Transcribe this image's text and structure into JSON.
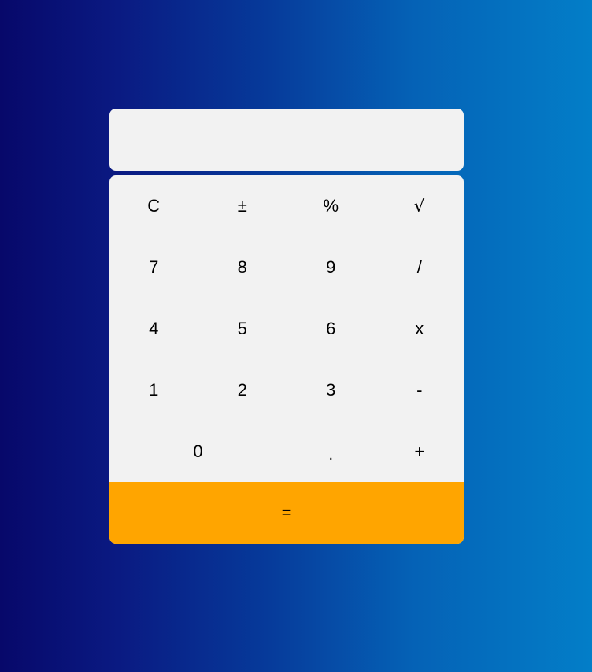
{
  "display": {
    "value": ""
  },
  "keys": {
    "clear": "C",
    "sign": "±",
    "percent": "%",
    "sqrt": "√",
    "seven": "7",
    "eight": "8",
    "nine": "9",
    "divide": "/",
    "four": "4",
    "five": "5",
    "six": "6",
    "multiply": "x",
    "one": "1",
    "two": "2",
    "three": "3",
    "minus": "-",
    "zero": "0",
    "dot": ".",
    "plus": "+",
    "equals": "="
  },
  "colors": {
    "panel": "#f2f2f2",
    "equals_background": "#ffa500",
    "gradient_start": "#07086a",
    "gradient_end": "#037ec8"
  }
}
